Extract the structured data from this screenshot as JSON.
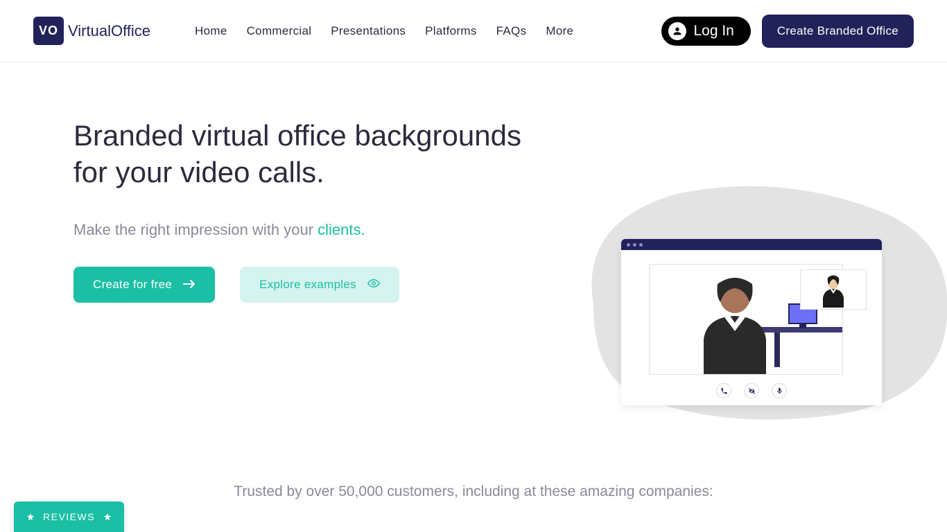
{
  "header": {
    "logo_badge": "VO",
    "logo_text": "VirtualOffice",
    "nav": [
      "Home",
      "Commercial",
      "Presentations",
      "Platforms",
      "FAQs",
      "More"
    ],
    "login_label": "Log In",
    "cta_label": "Create Branded Office"
  },
  "hero": {
    "title": "Branded virtual office backgrounds for your video calls.",
    "subtitle_prefix": "Make the right impression with your ",
    "subtitle_accent": "clients.",
    "primary_btn": "Create for free",
    "secondary_btn": "Explore examples"
  },
  "trusted": {
    "text": "Trusted by over 50,000 customers, including at these amazing companies:"
  },
  "reviews": {
    "label": "REVIEWS"
  },
  "colors": {
    "brand_dark": "#22225a",
    "accent": "#1bbfa5",
    "muted": "#8a8a9a"
  }
}
